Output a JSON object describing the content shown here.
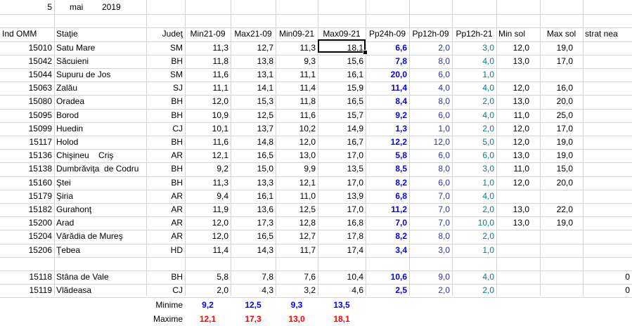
{
  "header": {
    "day": "5",
    "month": "mai",
    "year": "2019"
  },
  "columns": [
    "Ind OMM",
    "Staţie",
    "Judeţ",
    "Min21-09",
    "Max21-09",
    "Min09-21",
    "Max09-21",
    "Pp24h-09",
    "Pp12h-09",
    "Pp12h-21",
    "Min sol",
    "Max sol",
    "strat nea"
  ],
  "rows": [
    [
      "15010",
      "Satu Mare",
      "SM",
      "11,3",
      "12,7",
      "11,3",
      "18,1",
      "6,6",
      "2,0",
      "3,0",
      "12,0",
      "19,0",
      ""
    ],
    [
      "15042",
      "Săcuieni",
      "BH",
      "11,8",
      "13,8",
      "9,3",
      "15,6",
      "7,8",
      "8,0",
      "4,0",
      "13,0",
      "17,0",
      ""
    ],
    [
      "15044",
      "Supuru de Jos",
      "SM",
      "11,6",
      "13,1",
      "11,1",
      "16,1",
      "20,0",
      "6,0",
      "1,0",
      "",
      "",
      ""
    ],
    [
      "15063",
      "Zalău",
      "SJ",
      "11,1",
      "14,1",
      "11,4",
      "15,9",
      "11,4",
      "4,0",
      "4,0",
      "12,0",
      "16,0",
      ""
    ],
    [
      "15080",
      "Oradea",
      "BH",
      "12,0",
      "15,3",
      "11,8",
      "16,5",
      "8,4",
      "8,0",
      "2,0",
      "13,0",
      "20,0",
      ""
    ],
    [
      "15095",
      "Borod",
      "BH",
      "10,9",
      "12,5",
      "11,6",
      "15,7",
      "9,2",
      "6,0",
      "4,0",
      "11,0",
      "25,0",
      ""
    ],
    [
      "15099",
      "Huedin",
      "CJ",
      "10,1",
      "13,7",
      "10,2",
      "14,9",
      "1,3",
      "1,0",
      "2,0",
      "12,0",
      "17,0",
      ""
    ],
    [
      "15117",
      "Holod",
      "BH",
      "11,6",
      "14,8",
      "12,0",
      "16,7",
      "12,2",
      "12,0",
      "5,0",
      "12,0",
      "19,0",
      ""
    ],
    [
      "15136",
      "Chişineu    Criş",
      "AR",
      "12,1",
      "16,5",
      "13,0",
      "17,0",
      "5,8",
      "6,0",
      "6,0",
      "13,0",
      "19,0",
      ""
    ],
    [
      "15138",
      "Dumbrăviţa  de Codru",
      "BH",
      "9,2",
      "15,0",
      "9,9",
      "13,5",
      "8,5",
      "8,0",
      "3,0",
      "11,0",
      "15,0",
      ""
    ],
    [
      "15160",
      "Ştei",
      "BH",
      "11,3",
      "13,3",
      "12,1",
      "17,0",
      "8,2",
      "6,0",
      "1,0",
      "12,0",
      "20,0",
      ""
    ],
    [
      "15179",
      "Şiria",
      "AR",
      "9,4",
      "16,1",
      "11,0",
      "13,9",
      "6,8",
      "7,0",
      "4,0",
      "",
      "",
      ""
    ],
    [
      "15182",
      "Gurahonţ",
      "AR",
      "11,9",
      "13,6",
      "12,5",
      "17,0",
      "11,2",
      "7,0",
      "2,0",
      "13,0",
      "22,0",
      ""
    ],
    [
      "15200",
      "Arad",
      "AR",
      "12,0",
      "17,3",
      "12,8",
      "16,8",
      "7,0",
      "7,0",
      "10,0",
      "13,0",
      "19,0",
      ""
    ],
    [
      "15204",
      "Vărădia de Mureş",
      "AR",
      "12,0",
      "16,5",
      "12,7",
      "17,8",
      "8,2",
      "8,0",
      "2,0",
      "",
      "",
      ""
    ],
    [
      "15206",
      "Ţebea",
      "HD",
      "11,4",
      "14,3",
      "11,7",
      "17,4",
      "3,4",
      "3,0",
      "1,0",
      "",
      "",
      ""
    ]
  ],
  "mountain_rows": [
    [
      "15118",
      "Stâna de Vale",
      "BH",
      "5,8",
      "7,8",
      "7,6",
      "10,4",
      "10,6",
      "9,0",
      "4,0",
      "",
      "",
      "0"
    ],
    [
      "15119",
      "Vlădeasa",
      "CJ",
      "2,0",
      "4,3",
      "3,2",
      "4,6",
      "2,5",
      "2,0",
      "2,0",
      "",
      "",
      "0"
    ]
  ],
  "summary": {
    "min_label": "Minime",
    "max_label": "Maxime",
    "min_values": [
      "9,2",
      "12,5",
      "9,3",
      "13,5"
    ],
    "max_values": [
      "12,1",
      "17,3",
      "13,0",
      "18,1"
    ]
  },
  "colors": {
    "blue": "#0000ff",
    "red": "#ff0000",
    "navy": "#33339a",
    "teal": "#008080",
    "grid": "#d4d4d4"
  },
  "selected_cell": "Max09-21 / 15010"
}
